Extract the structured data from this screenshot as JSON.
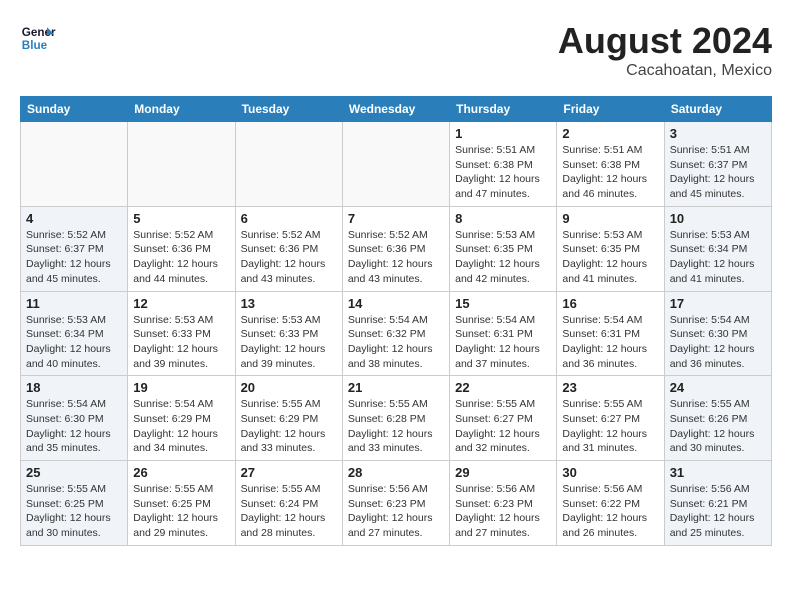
{
  "logo": {
    "line1": "General",
    "line2": "Blue"
  },
  "title": "August 2024",
  "location": "Cacahoatan, Mexico",
  "weekdays": [
    "Sunday",
    "Monday",
    "Tuesday",
    "Wednesday",
    "Thursday",
    "Friday",
    "Saturday"
  ],
  "weeks": [
    [
      {
        "day": "",
        "info": ""
      },
      {
        "day": "",
        "info": ""
      },
      {
        "day": "",
        "info": ""
      },
      {
        "day": "",
        "info": ""
      },
      {
        "day": "1",
        "info": "Sunrise: 5:51 AM\nSunset: 6:38 PM\nDaylight: 12 hours\nand 47 minutes."
      },
      {
        "day": "2",
        "info": "Sunrise: 5:51 AM\nSunset: 6:38 PM\nDaylight: 12 hours\nand 46 minutes."
      },
      {
        "day": "3",
        "info": "Sunrise: 5:51 AM\nSunset: 6:37 PM\nDaylight: 12 hours\nand 45 minutes."
      }
    ],
    [
      {
        "day": "4",
        "info": "Sunrise: 5:52 AM\nSunset: 6:37 PM\nDaylight: 12 hours\nand 45 minutes."
      },
      {
        "day": "5",
        "info": "Sunrise: 5:52 AM\nSunset: 6:36 PM\nDaylight: 12 hours\nand 44 minutes."
      },
      {
        "day": "6",
        "info": "Sunrise: 5:52 AM\nSunset: 6:36 PM\nDaylight: 12 hours\nand 43 minutes."
      },
      {
        "day": "7",
        "info": "Sunrise: 5:52 AM\nSunset: 6:36 PM\nDaylight: 12 hours\nand 43 minutes."
      },
      {
        "day": "8",
        "info": "Sunrise: 5:53 AM\nSunset: 6:35 PM\nDaylight: 12 hours\nand 42 minutes."
      },
      {
        "day": "9",
        "info": "Sunrise: 5:53 AM\nSunset: 6:35 PM\nDaylight: 12 hours\nand 41 minutes."
      },
      {
        "day": "10",
        "info": "Sunrise: 5:53 AM\nSunset: 6:34 PM\nDaylight: 12 hours\nand 41 minutes."
      }
    ],
    [
      {
        "day": "11",
        "info": "Sunrise: 5:53 AM\nSunset: 6:34 PM\nDaylight: 12 hours\nand 40 minutes."
      },
      {
        "day": "12",
        "info": "Sunrise: 5:53 AM\nSunset: 6:33 PM\nDaylight: 12 hours\nand 39 minutes."
      },
      {
        "day": "13",
        "info": "Sunrise: 5:53 AM\nSunset: 6:33 PM\nDaylight: 12 hours\nand 39 minutes."
      },
      {
        "day": "14",
        "info": "Sunrise: 5:54 AM\nSunset: 6:32 PM\nDaylight: 12 hours\nand 38 minutes."
      },
      {
        "day": "15",
        "info": "Sunrise: 5:54 AM\nSunset: 6:31 PM\nDaylight: 12 hours\nand 37 minutes."
      },
      {
        "day": "16",
        "info": "Sunrise: 5:54 AM\nSunset: 6:31 PM\nDaylight: 12 hours\nand 36 minutes."
      },
      {
        "day": "17",
        "info": "Sunrise: 5:54 AM\nSunset: 6:30 PM\nDaylight: 12 hours\nand 36 minutes."
      }
    ],
    [
      {
        "day": "18",
        "info": "Sunrise: 5:54 AM\nSunset: 6:30 PM\nDaylight: 12 hours\nand 35 minutes."
      },
      {
        "day": "19",
        "info": "Sunrise: 5:54 AM\nSunset: 6:29 PM\nDaylight: 12 hours\nand 34 minutes."
      },
      {
        "day": "20",
        "info": "Sunrise: 5:55 AM\nSunset: 6:29 PM\nDaylight: 12 hours\nand 33 minutes."
      },
      {
        "day": "21",
        "info": "Sunrise: 5:55 AM\nSunset: 6:28 PM\nDaylight: 12 hours\nand 33 minutes."
      },
      {
        "day": "22",
        "info": "Sunrise: 5:55 AM\nSunset: 6:27 PM\nDaylight: 12 hours\nand 32 minutes."
      },
      {
        "day": "23",
        "info": "Sunrise: 5:55 AM\nSunset: 6:27 PM\nDaylight: 12 hours\nand 31 minutes."
      },
      {
        "day": "24",
        "info": "Sunrise: 5:55 AM\nSunset: 6:26 PM\nDaylight: 12 hours\nand 30 minutes."
      }
    ],
    [
      {
        "day": "25",
        "info": "Sunrise: 5:55 AM\nSunset: 6:25 PM\nDaylight: 12 hours\nand 30 minutes."
      },
      {
        "day": "26",
        "info": "Sunrise: 5:55 AM\nSunset: 6:25 PM\nDaylight: 12 hours\nand 29 minutes."
      },
      {
        "day": "27",
        "info": "Sunrise: 5:55 AM\nSunset: 6:24 PM\nDaylight: 12 hours\nand 28 minutes."
      },
      {
        "day": "28",
        "info": "Sunrise: 5:56 AM\nSunset: 6:23 PM\nDaylight: 12 hours\nand 27 minutes."
      },
      {
        "day": "29",
        "info": "Sunrise: 5:56 AM\nSunset: 6:23 PM\nDaylight: 12 hours\nand 27 minutes."
      },
      {
        "day": "30",
        "info": "Sunrise: 5:56 AM\nSunset: 6:22 PM\nDaylight: 12 hours\nand 26 minutes."
      },
      {
        "day": "31",
        "info": "Sunrise: 5:56 AM\nSunset: 6:21 PM\nDaylight: 12 hours\nand 25 minutes."
      }
    ]
  ]
}
